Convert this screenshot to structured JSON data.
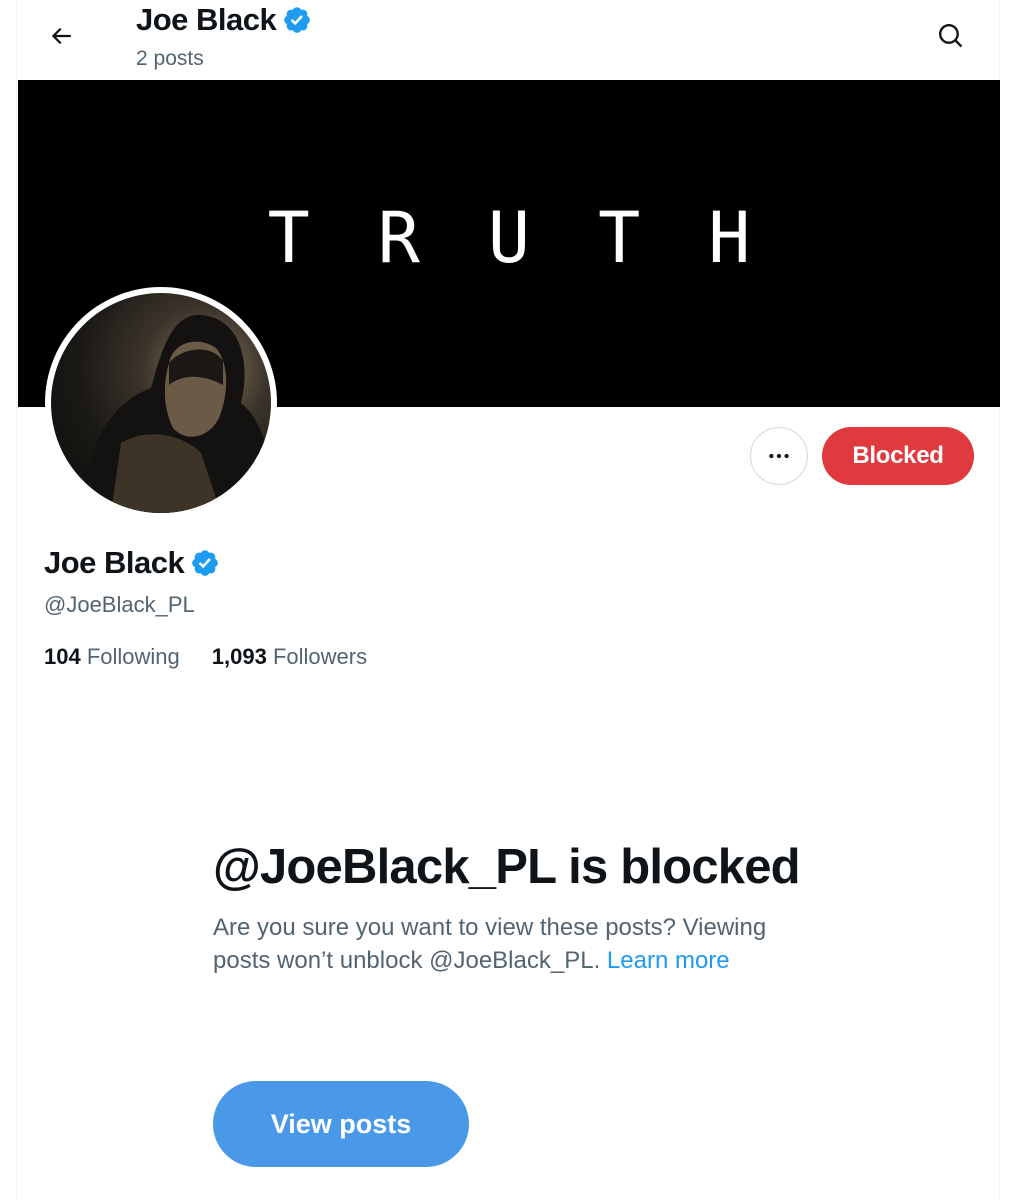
{
  "header": {
    "back_icon": "arrow-left-icon",
    "name": "Joe Black",
    "verified_icon": "verified-badge-icon",
    "posts_count": "2 posts",
    "search_icon": "search-icon"
  },
  "banner": {
    "text": "TRUTH",
    "background": "#000000"
  },
  "actions": {
    "more_icon": "more-horizontal-icon",
    "blocked_label": "Blocked",
    "blocked_color": "#e0393e"
  },
  "profile": {
    "name": "Joe Black",
    "handle": "@JoeBlack_PL",
    "following_count": "104",
    "following_label": "Following",
    "followers_count": "1,093",
    "followers_label": "Followers"
  },
  "blocked_notice": {
    "title": "@JoeBlack_PL is blocked",
    "body": "Are you sure you want to view these posts? Viewing posts won’t unblock @JoeBlack_PL.",
    "learn_more": "Learn more",
    "view_posts_label": "View posts",
    "accent_color": "#1d9bf0"
  }
}
